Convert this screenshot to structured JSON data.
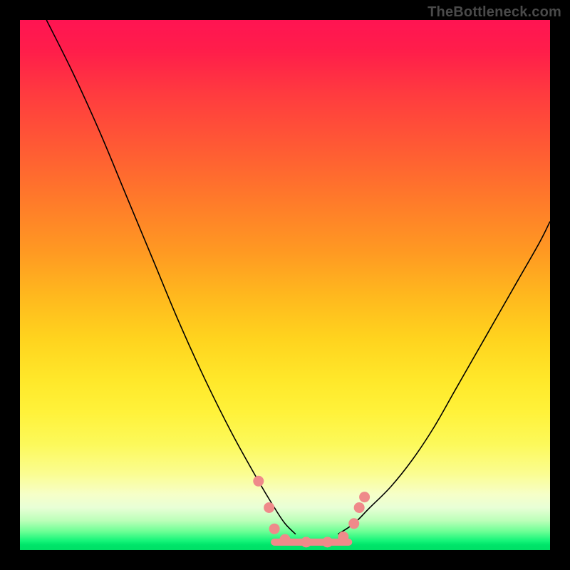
{
  "watermark": "TheBottleneck.com",
  "colors": {
    "frame_bg": "#000000",
    "marker": "#ef8a8a",
    "curve": "#000000",
    "gradient_top": "#ff1452",
    "gradient_bottom": "#00df66"
  },
  "chart_data": {
    "type": "line",
    "title": "",
    "xlabel": "",
    "ylabel": "",
    "xlim": [
      0,
      100
    ],
    "ylim": [
      0,
      100
    ],
    "notes": "Background is a vertical red→yellow→green gradient. Two black curves form a V shape. Pink markers and a pink floor segment sit near the valley indicating the optimal / zero-bottleneck region.",
    "series": [
      {
        "name": "left-curve",
        "x": [
          5,
          10,
          15,
          20,
          25,
          30,
          35,
          40,
          45,
          48,
          50,
          52
        ],
        "y": [
          100,
          90,
          79,
          67,
          55,
          43,
          32,
          22,
          13,
          8,
          5,
          3
        ]
      },
      {
        "name": "right-curve",
        "x": [
          60,
          63,
          66,
          70,
          74,
          78,
          82,
          86,
          90,
          94,
          98,
          100
        ],
        "y": [
          3,
          5,
          8,
          12,
          17,
          23,
          30,
          37,
          44,
          51,
          58,
          62
        ]
      }
    ],
    "floor_segment": {
      "x_start": 48,
      "x_end": 62,
      "y": 1.5
    },
    "markers": [
      {
        "x": 45,
        "y": 13
      },
      {
        "x": 47,
        "y": 8
      },
      {
        "x": 48,
        "y": 4
      },
      {
        "x": 50,
        "y": 2
      },
      {
        "x": 54,
        "y": 1.5
      },
      {
        "x": 58,
        "y": 1.5
      },
      {
        "x": 61,
        "y": 2.5
      },
      {
        "x": 63,
        "y": 5
      },
      {
        "x": 64,
        "y": 8
      },
      {
        "x": 65,
        "y": 10
      }
    ]
  }
}
